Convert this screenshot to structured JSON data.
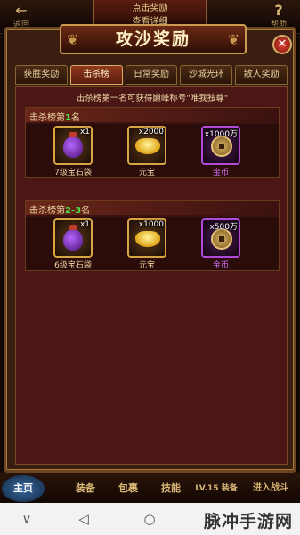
{
  "top": {
    "left_label": "返回",
    "left_glyph": "←",
    "right_label": "帮助",
    "right_glyph": "?",
    "center_line1": "点击奖励",
    "center_line2": "查看详细"
  },
  "dialog": {
    "title": "攻沙奖励",
    "close_glyph": "✕",
    "tabs": [
      "获胜奖励",
      "击杀榜",
      "日常奖励",
      "沙城光环",
      "散人奖励"
    ],
    "active_tab": 1,
    "notice": "击杀榜第一名可获得巅峰称号\"唯我独尊\"",
    "sections": [
      {
        "title_prefix": "击杀榜第",
        "rank": "1",
        "title_suffix": "名",
        "items": [
          {
            "name": "7级宝石袋",
            "qty": "x1",
            "icon": "gem-bag-icon",
            "rarity": "gold"
          },
          {
            "name": "元宝",
            "qty": "x2000",
            "icon": "gold-ingot-icon",
            "rarity": "gold"
          },
          {
            "name": "金币",
            "qty": "x1000万",
            "icon": "coin-icon",
            "rarity": "purple"
          }
        ]
      },
      {
        "title_prefix": "击杀榜第",
        "rank": "2-3",
        "title_suffix": "名",
        "items": [
          {
            "name": "6级宝石袋",
            "qty": "x1",
            "icon": "gem-bag-icon",
            "rarity": "gold"
          },
          {
            "name": "元宝",
            "qty": "x1000",
            "icon": "gold-ingot-icon",
            "rarity": "gold"
          },
          {
            "name": "金币",
            "qty": "x500万",
            "icon": "coin-icon",
            "rarity": "purple"
          }
        ]
      }
    ]
  },
  "bottom_menu": {
    "main": "主页",
    "items": [
      "装备",
      "包裹",
      "技能",
      "LV.15 装备",
      "进入战斗"
    ]
  },
  "android_nav": {
    "back": "◁",
    "home": "○",
    "recents": "□",
    "menu": "∨"
  },
  "watermark": "脉冲手游网",
  "colors": {
    "accent_gold": "#d8a542",
    "rank_green": "#4de04a",
    "purple_rarity": "#b04ad8",
    "panel_red": "#4a1714"
  }
}
